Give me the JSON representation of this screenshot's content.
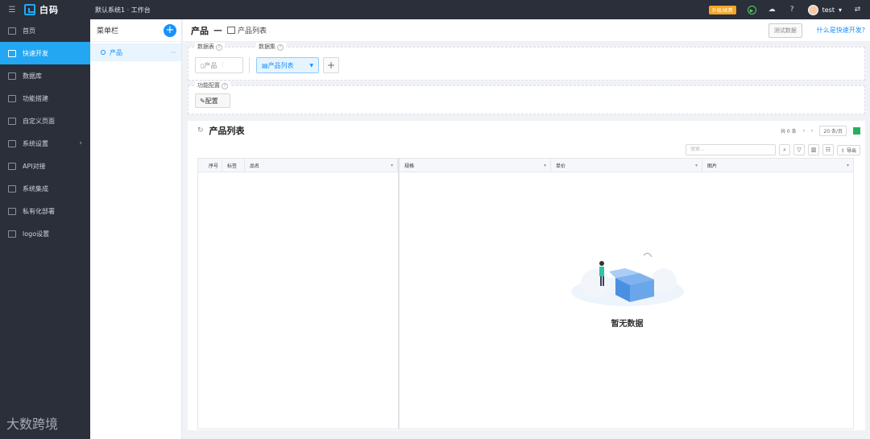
{
  "topbar": {
    "brand": "白码",
    "breadcrumb": "默认系统1 · 工作台",
    "upgrade": "升级/续费",
    "user": "test"
  },
  "sidebar": {
    "items": [
      {
        "label": "首页"
      },
      {
        "label": "快速开发"
      },
      {
        "label": "数据库"
      },
      {
        "label": "功能搭建"
      },
      {
        "label": "自定义页面"
      },
      {
        "label": "系统设置"
      },
      {
        "label": "API对接"
      },
      {
        "label": "系统集成"
      },
      {
        "label": "私有化部署"
      },
      {
        "label": "logo设置"
      }
    ],
    "watermark": "大数跨境"
  },
  "menucol": {
    "title": "菜单栏",
    "entry": "产品"
  },
  "header": {
    "title": "产品",
    "dash": "—",
    "subtitle": "产品列表",
    "test_btn": "测试数据",
    "help": "什么是快速开发?"
  },
  "config": {
    "table_label": "数据表",
    "dataset_label": "数据集",
    "table_value": "产品",
    "dataset_value": "产品列表",
    "func_label": "功能配置",
    "config_btn": "配置"
  },
  "list": {
    "title": "产品列表",
    "total": "共 0 条",
    "page_size": "20 条/页",
    "search_placeholder": "搜索...",
    "export": "导出",
    "columns": [
      "序号",
      "标签",
      "品名",
      "规格",
      "单价",
      "图片"
    ],
    "empty": "暂无数据"
  },
  "colors": {
    "accent": "#1890ff",
    "sidebar_bg": "#2b2f3a",
    "active": "#23a7f2",
    "upgrade": "#f5a623"
  }
}
